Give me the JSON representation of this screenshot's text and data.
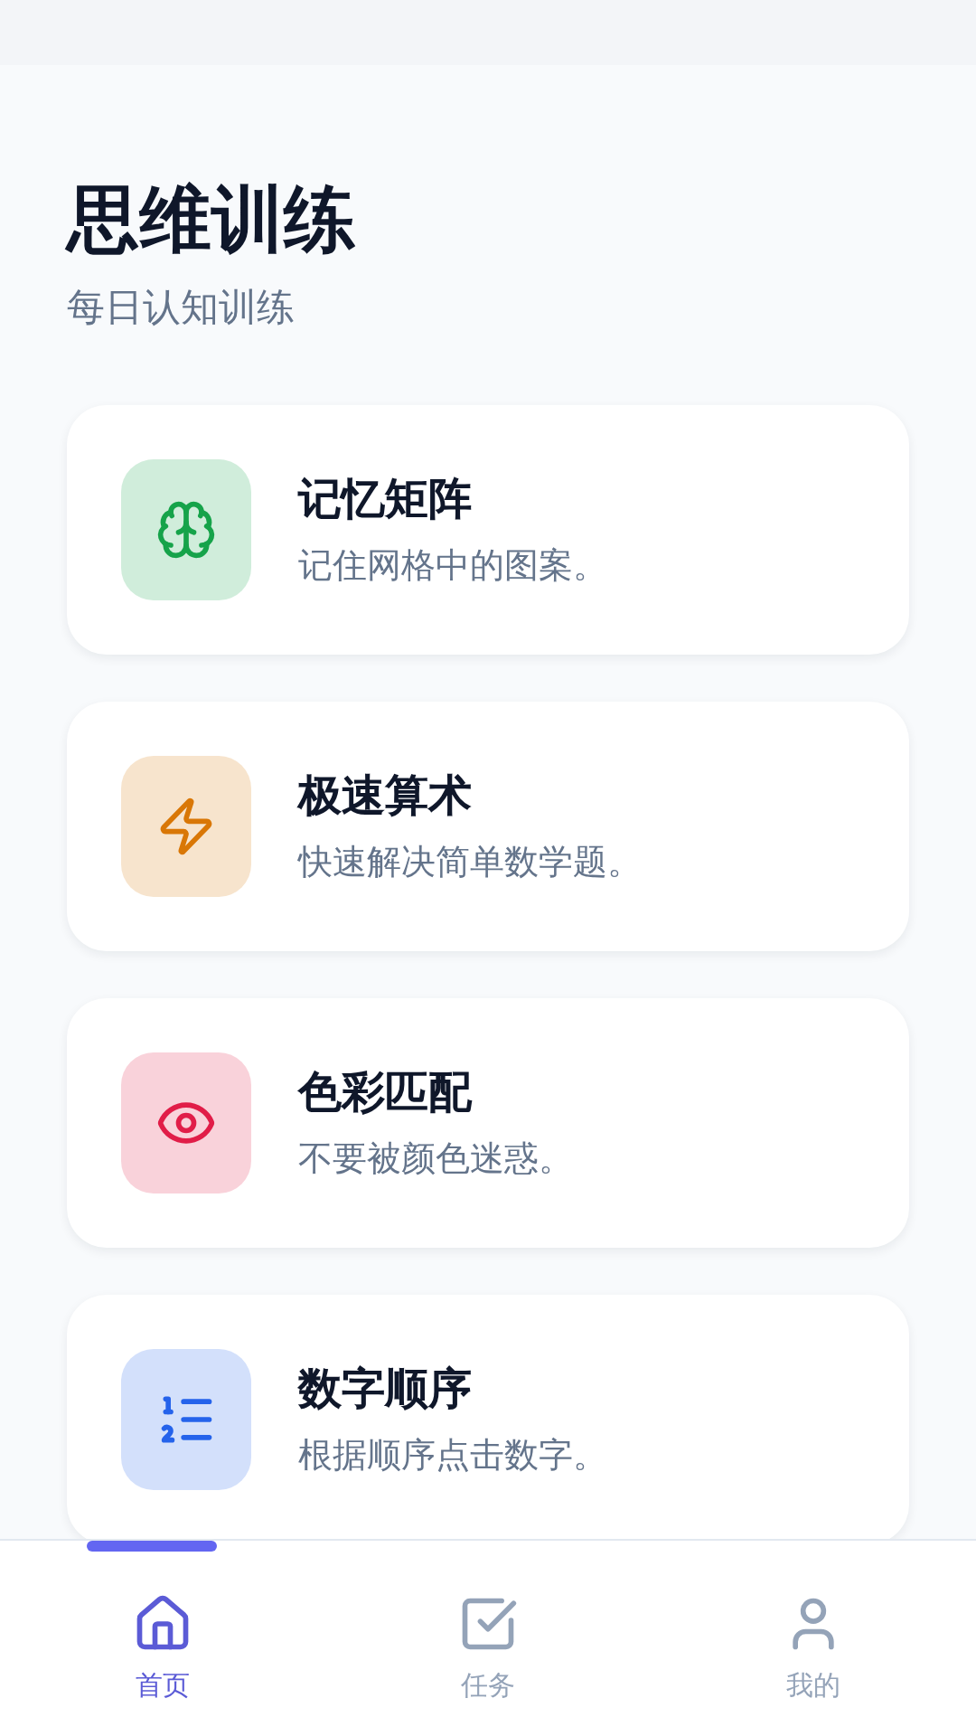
{
  "header": {
    "title": "思维训练",
    "subtitle": "每日认知训练"
  },
  "games": [
    {
      "title": "记忆矩阵",
      "description": "记住网格中的图案。",
      "color": "#16a34a"
    },
    {
      "title": "极速算术",
      "description": "快速解决简单数学题。",
      "color": "#d97706"
    },
    {
      "title": "色彩匹配",
      "description": "不要被颜色迷惑。",
      "color": "#e11d48"
    },
    {
      "title": "数字顺序",
      "description": "根据顺序点击数字。",
      "color": "#2563eb"
    }
  ],
  "tabs": [
    {
      "label": "首页",
      "selected": true
    },
    {
      "label": "任务",
      "selected": false
    },
    {
      "label": "我的",
      "selected": false
    }
  ]
}
